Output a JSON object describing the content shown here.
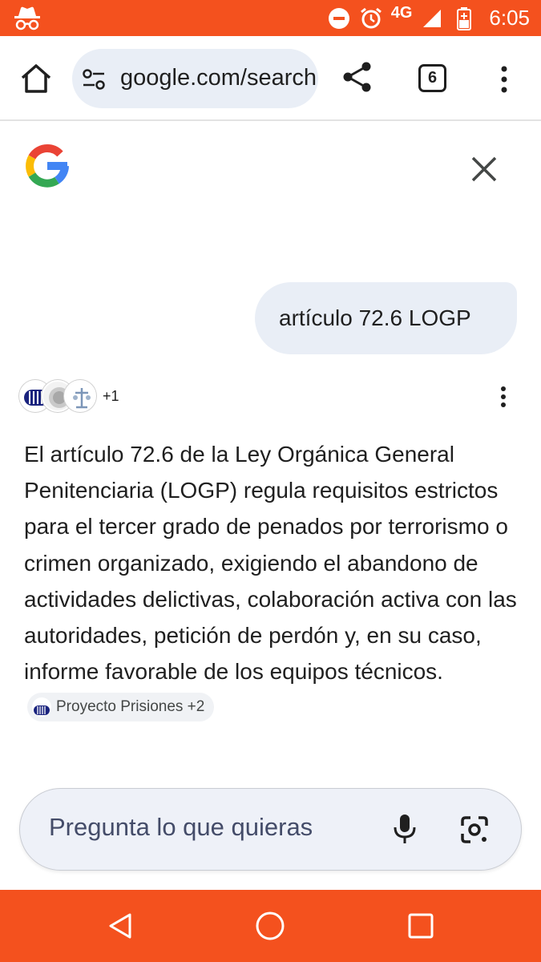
{
  "status_bar": {
    "network": "4G",
    "time": "6:05",
    "icons": [
      "incognito-icon",
      "dnd-icon",
      "alarm-icon",
      "signal-icon",
      "battery-charging-icon"
    ]
  },
  "browser": {
    "url": "google.com/search",
    "tab_count": "6",
    "icons": [
      "home-icon",
      "site-settings-icon",
      "share-icon",
      "more-vert-icon"
    ]
  },
  "search": {
    "query": "artículo 72.6 LOGP",
    "sources_extra": "+1",
    "answer": "El artículo 72.6 de la Ley Orgánica General Penitenciaria (LOGP) regula requisitos estrictos para el tercer grado de penados por terrorismo o crimen organizado, exigiendo el abandono de actividades delictivas, colaboración activa con las autoridades, petición de perdón y, en su caso, informe favorable de los equipos técnicos.",
    "citation_label": "Proyecto Prisiones +2",
    "ask_placeholder": "Pregunta lo que quieras"
  },
  "colors": {
    "accent": "#f4511e",
    "bubble": "#e9eef6"
  }
}
